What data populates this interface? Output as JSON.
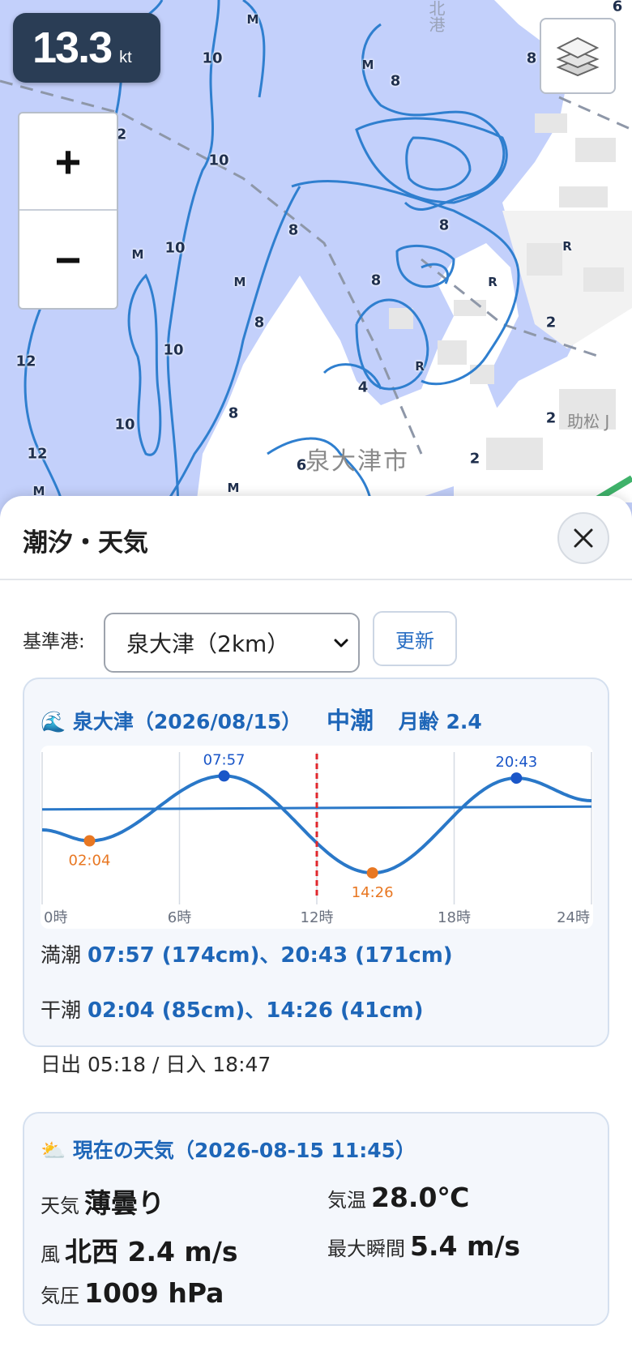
{
  "map": {
    "speed_value": "13.3",
    "speed_unit": "kt",
    "zoom_in_label": "+",
    "zoom_out_label": "−",
    "place_label": "泉大津市",
    "place_label_2": "助松 J",
    "port_label": "北港",
    "depth_labels": [
      "10",
      "10",
      "10",
      "10",
      "10",
      "12",
      "12",
      "2",
      "8",
      "8",
      "8",
      "8",
      "8",
      "8",
      "8",
      "4",
      "6",
      "6",
      "2",
      "2",
      "2"
    ],
    "m_markers": [
      "M",
      "M",
      "M",
      "M",
      "M",
      "M"
    ],
    "r_markers": [
      "R",
      "R",
      "R"
    ],
    "colors": {
      "water": "#c3d0fb",
      "land": "#ffffff",
      "contour": "#2f7fcf"
    }
  },
  "sheet": {
    "title": "潮汐・天気",
    "close_icon": "close-icon",
    "port_label": "基準港:",
    "port_selected": "泉大津（2km）",
    "refresh_label": "更新"
  },
  "tide": {
    "icon": "🌊",
    "heading": "泉大津（2026/08/15）",
    "tide_type": "中潮",
    "moon_age": "月齢 2.4",
    "high_label": "満潮",
    "high_value": "07:57 (174cm)、20:43 (171cm)",
    "low_label": "干潮",
    "low_value": "02:04 (85cm)、14:26 (41cm)",
    "sun_value": "日出 05:18 / 日入 18:47",
    "colors": {
      "curve": "#2a78c8",
      "high_point": "#1a56c8",
      "low_point": "#e87722",
      "now_line": "#e0282e"
    }
  },
  "chart_data": {
    "type": "line",
    "x_ticks": [
      "0時",
      "6時",
      "12時",
      "18時",
      "24時"
    ],
    "xlim": [
      0,
      24
    ],
    "ylim": [
      20,
      200
    ],
    "now_hour": 12.0,
    "series": [
      {
        "values_x": [
          0,
          2.07,
          7.95,
          14.43,
          20.72,
          24
        ],
        "values_y": [
          100,
          85,
          174,
          41,
          171,
          140
        ]
      }
    ],
    "mean_line": {
      "x": [
        0,
        24
      ],
      "y": [
        128,
        132
      ]
    },
    "highs": [
      {
        "label": "07:57",
        "x": 7.95,
        "y": 174
      },
      {
        "label": "20:43",
        "x": 20.72,
        "y": 171
      }
    ],
    "lows": [
      {
        "label": "02:04",
        "x": 2.07,
        "y": 85
      },
      {
        "label": "14:26",
        "x": 14.43,
        "y": 41
      }
    ],
    "grid": true
  },
  "weather": {
    "icon": "⛅",
    "heading": "現在の天気（2026-08-15 11:45）",
    "cond_label": "天気",
    "cond_value": "薄曇り",
    "temp_label": "気温",
    "temp_value": "28.0℃",
    "wind_label": "風",
    "wind_value": "北西 2.4 m/s",
    "gust_label": "最大瞬間",
    "gust_value": "5.4 m/s",
    "pressure_label": "気圧",
    "pressure_value": "1009 hPa"
  }
}
